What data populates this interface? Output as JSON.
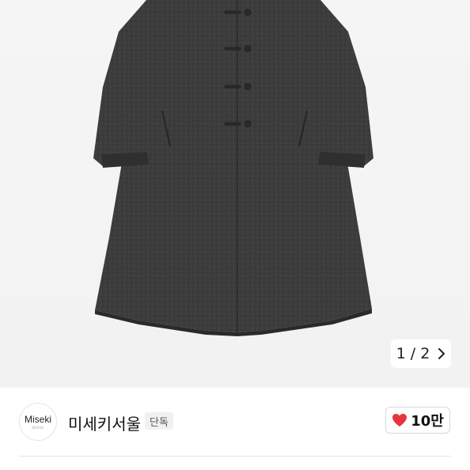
{
  "gallery": {
    "current_page": "1",
    "separator": "/",
    "total_pages": "2",
    "image_alt": "Charcoal wool long coat with frog-button closure",
    "next_icon": "chevron-right-icon"
  },
  "brand": {
    "logo_text": "Miseki",
    "logo_subtext": "SEOUL",
    "name": "미세키서울",
    "badge": "단독"
  },
  "like": {
    "icon": "heart-icon",
    "icon_color": "#e8343f",
    "count": "10만"
  }
}
